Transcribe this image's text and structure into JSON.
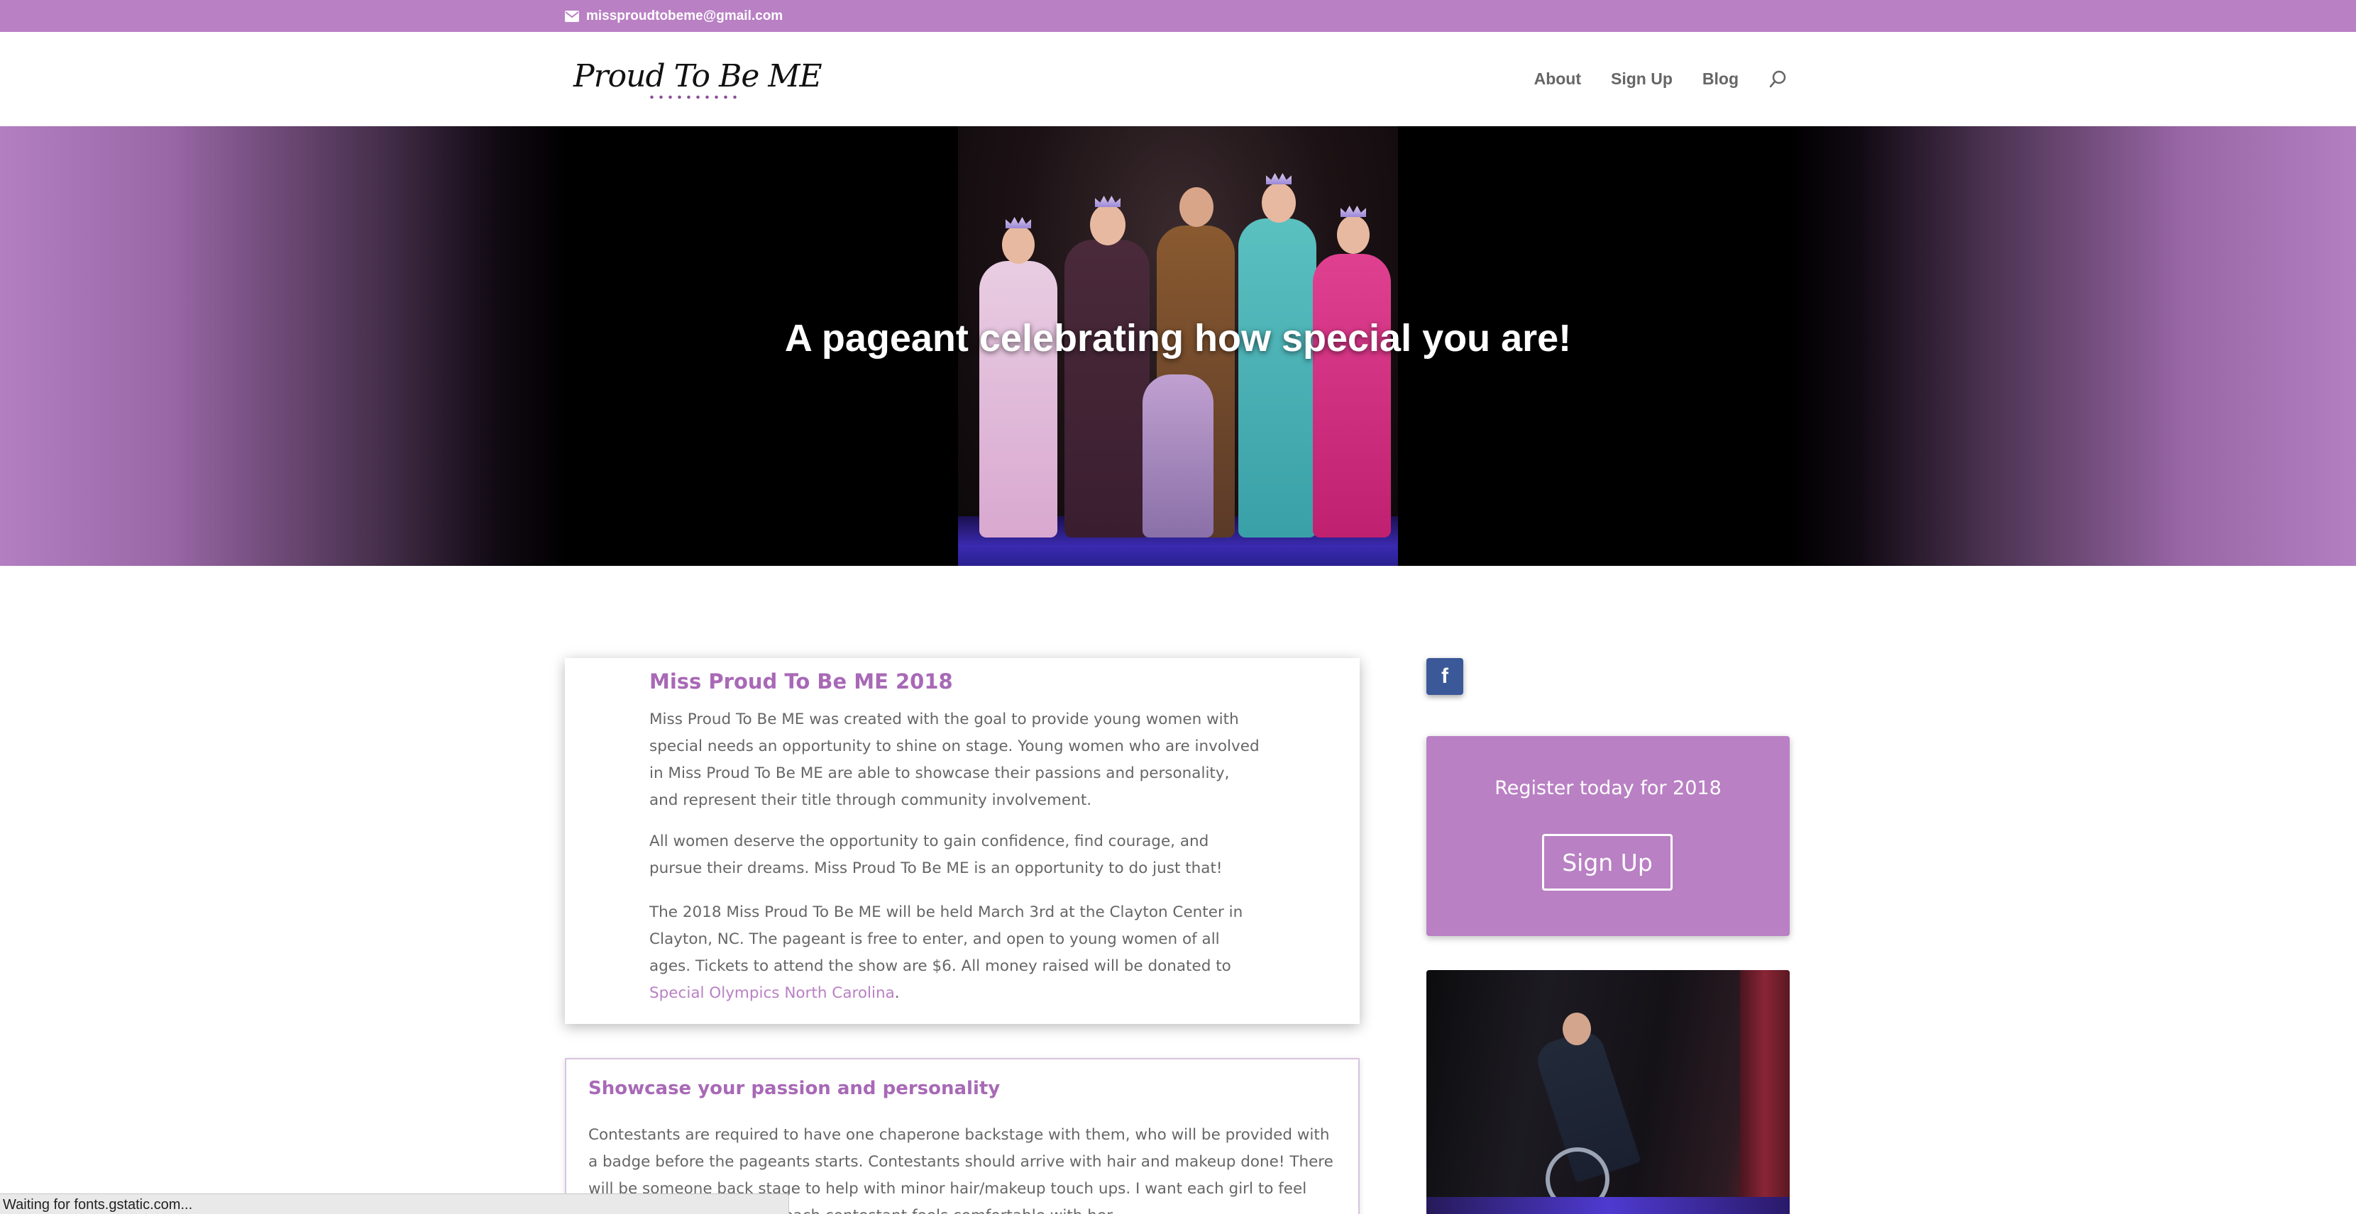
{
  "topbar": {
    "email": "missproudtobeme@gmail.com",
    "icon": "mail-icon",
    "background": "#b980c4"
  },
  "header": {
    "logo_text": "Proud To Be ME",
    "nav": {
      "about": "About",
      "sign_up": "Sign Up",
      "blog": "Blog"
    },
    "search_icon": "search-icon"
  },
  "hero": {
    "title": "A pageant celebrating how special you are!"
  },
  "main": {
    "card1": {
      "title": "Miss Proud To Be ME 2018",
      "p1": "Miss Proud To Be ME was created with the goal to provide young women with special needs an opportunity to shine on stage. Young women who are involved in Miss Proud To Be ME are able to showcase their passions and personality, and represent their title through community involvement.",
      "p2": "All women deserve the opportunity to gain confidence, find courage, and pursue their dreams. Miss Proud To Be ME is an opportunity to do just that!",
      "p3_text": "The 2018 Miss Proud To Be ME will be held March 3rd at the Clayton Center in Clayton, NC. The pageant is free to enter, and open to young women of all ages. Tickets to attend the show are $6. All money raised will be donated to ",
      "p3_link": "Special Olympics North Carolina",
      "p3_end": "."
    },
    "card2": {
      "title": "Showcase your passion and personality",
      "p": "Contestants are required to have one chaperone backstage with them, who will be provided with a badge before the pageants starts. Contestants should arrive with hair and makeup done! There will be someone back stage to help with minor hair/makeup touch ups. I want each girl to feel beautiful, and make sure each contestant feels comfortable with her"
    }
  },
  "sidebar": {
    "facebook_icon": "facebook-icon",
    "facebook_glyph": "f",
    "register_text": "Register today for 2018",
    "register_button": "Sign Up"
  },
  "status_bar": {
    "text": "Waiting for fonts.gstatic.com..."
  },
  "colors": {
    "accent": "#b980c4",
    "heading": "#a869b6",
    "facebook": "#3b5998"
  }
}
